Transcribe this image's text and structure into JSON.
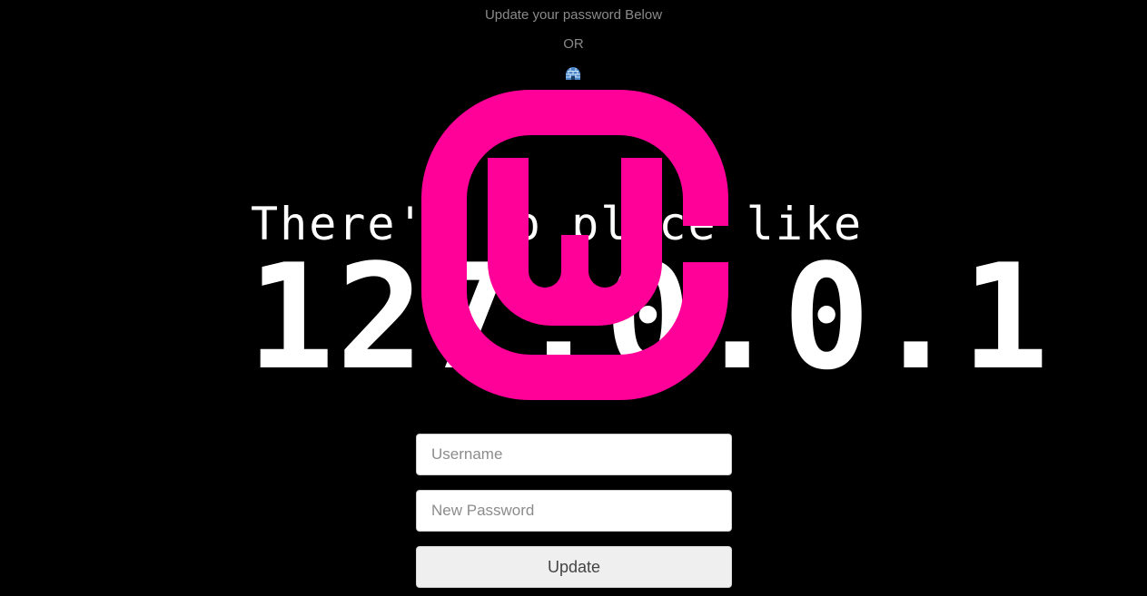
{
  "header": {
    "subtitle": "Update your password Below",
    "or_text": "OR",
    "igloo_icon": "igloo-icon"
  },
  "hero": {
    "line1": "There's no place like",
    "line2": "127.0.0.1",
    "logo_icon": "wampserver-logo",
    "logo_color": "#ff0099"
  },
  "form": {
    "username_placeholder": "Username",
    "username_value": "",
    "password_placeholder": "New Password",
    "password_value": "",
    "submit_label": "Update"
  },
  "colors": {
    "background": "#000000",
    "accent": "#ff0099",
    "muted_text": "#8a8a8a"
  }
}
